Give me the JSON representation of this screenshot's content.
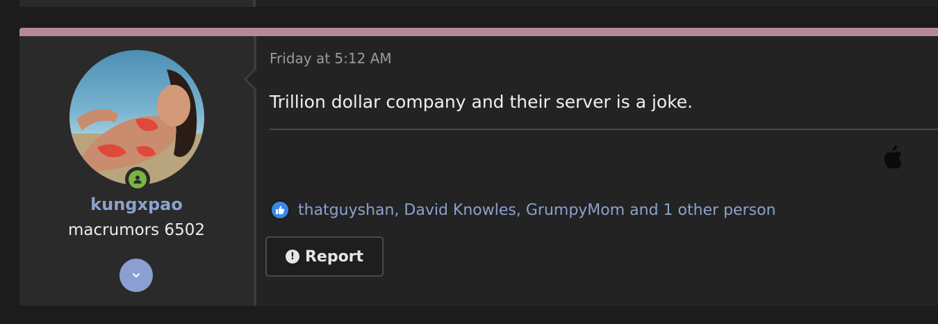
{
  "post": {
    "timestamp": "Friday at 5:12 AM",
    "message": "Trillion dollar company and their server is a joke.",
    "accent_color": "#b7889a"
  },
  "author": {
    "username": "kungxpao",
    "title": "macrumors 6502",
    "online_status": "online",
    "avatar": "avatar-image"
  },
  "signature": {
    "icon": "apple-logo-icon"
  },
  "reactions": {
    "icon": "like-icon",
    "text": "thatguyshan, David Knowles, GrumpyMom and 1 other person"
  },
  "actions": {
    "report_label": "Report",
    "expand_icon": "chevron-down-icon"
  }
}
